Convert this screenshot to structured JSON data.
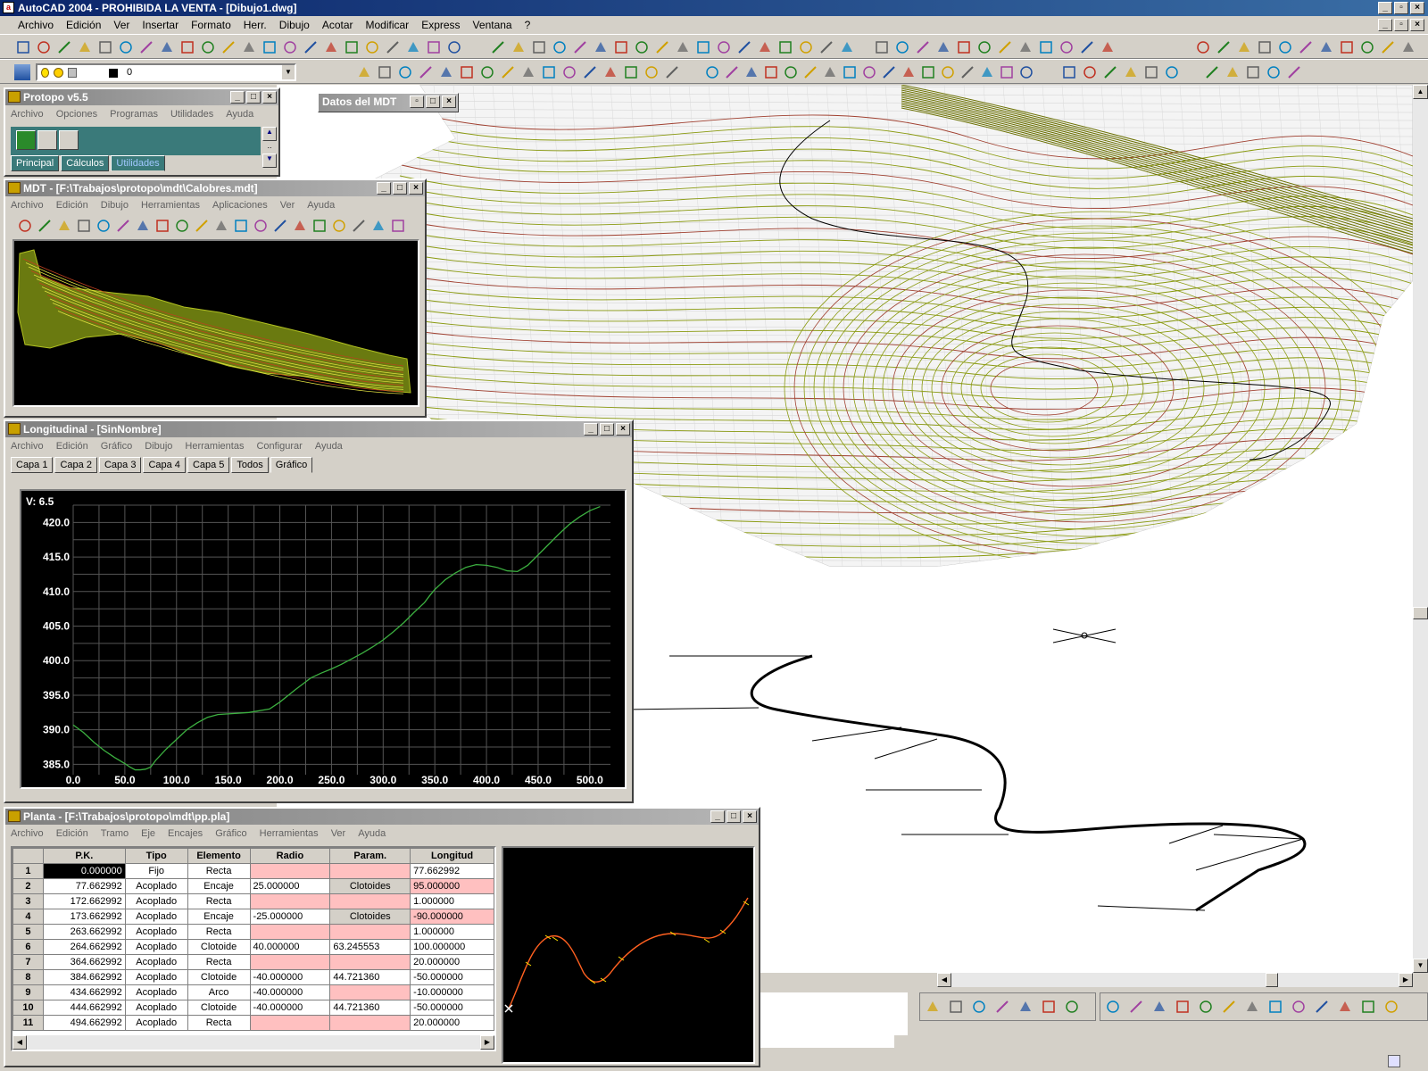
{
  "app": {
    "title": "AutoCAD 2004 - PROHIBIDA LA VENTA - [Dibujo1.dwg]",
    "menu": [
      "Archivo",
      "Edición",
      "Ver",
      "Insertar",
      "Formato",
      "Herr.",
      "Dibujo",
      "Acotar",
      "Modificar",
      "Express",
      "Ventana",
      "?"
    ],
    "layer_value": "0"
  },
  "protopo": {
    "title": "Protopo v5.5",
    "menu": [
      "Archivo",
      "Opciones",
      "Programas",
      "Utilidades",
      "Ayuda"
    ],
    "tabs": [
      "Principal",
      "Cálculos",
      "Utilidades"
    ]
  },
  "datos_mdt": {
    "title": "Datos del MDT"
  },
  "mdt": {
    "title": "MDT - [F:\\Trabajos\\protopo\\mdt\\Calobres.mdt]",
    "menu": [
      "Archivo",
      "Edición",
      "Dibujo",
      "Herramientas",
      "Aplicaciones",
      "Ver",
      "Ayuda"
    ]
  },
  "longitudinal": {
    "title": "Longitudinal - [SinNombre]",
    "menu": [
      "Archivo",
      "Edición",
      "Gráfico",
      "Dibujo",
      "Herramientas",
      "Configurar",
      "Ayuda"
    ],
    "tabs": [
      "Capa 1",
      "Capa 2",
      "Capa 3",
      "Capa 4",
      "Capa 5",
      "Todos",
      "Gráfico"
    ],
    "readout": "V: 6.5"
  },
  "chart_data": {
    "type": "line",
    "series": [
      {
        "x": [
          0,
          10,
          20,
          30,
          40,
          50,
          55,
          60,
          65,
          70,
          75,
          80,
          90,
          100,
          110,
          120,
          130,
          140,
          150,
          170,
          190,
          200,
          215,
          230,
          240,
          250,
          260,
          270,
          280,
          290,
          300,
          310,
          320,
          330,
          340,
          345,
          350,
          355,
          360,
          370,
          380,
          390,
          400,
          410,
          420,
          430,
          440,
          450,
          460,
          470,
          480,
          490,
          500,
          510
        ],
        "y": [
          390.7,
          389.6,
          388.2,
          387.0,
          386.0,
          385.1,
          384.6,
          384.2,
          384.2,
          384.3,
          384.6,
          385.6,
          387.2,
          388.6,
          390.0,
          391.0,
          391.8,
          392.2,
          392.3,
          392.5,
          393.0,
          394.0,
          395.8,
          397.5,
          398.2,
          398.8,
          399.5,
          400.3,
          401.1,
          402.0,
          403.0,
          404.2,
          405.5,
          407.0,
          408.4,
          409.4,
          410.3,
          411.0,
          411.7,
          412.7,
          413.5,
          413.9,
          413.8,
          413.5,
          413.0,
          412.9,
          413.8,
          415.3,
          416.8,
          418.3,
          419.7,
          420.8,
          421.7,
          422.3
        ]
      }
    ],
    "xticks": [
      "0.0",
      "50.0",
      "100.0",
      "150.0",
      "200.0",
      "250.0",
      "300.0",
      "350.0",
      "400.0",
      "450.0",
      "500.0"
    ],
    "yticks": [
      "385.0",
      "390.0",
      "395.0",
      "400.0",
      "405.0",
      "410.0",
      "415.0",
      "420.0"
    ],
    "xlim": [
      0,
      520
    ],
    "ylim": [
      383.5,
      422.5
    ],
    "grid": true,
    "line_color": "#3cb040",
    "background": "#000000"
  },
  "planta": {
    "title": "Planta - [F:\\Trabajos\\protopo\\mdt\\pp.pla]",
    "menu": [
      "Archivo",
      "Edición",
      "Tramo",
      "Eje",
      "Encajes",
      "Gráfico",
      "Herramientas",
      "Ver",
      "Ayuda"
    ],
    "columns": [
      "P.K.",
      "Tipo",
      "Elemento",
      "Radio",
      "Param.",
      "Longitud"
    ],
    "rows": [
      {
        "n": "1",
        "pk": "0.000000",
        "tipo": "Fijo",
        "elem": "Recta",
        "radio": "",
        "param": "",
        "long": "77.662992"
      },
      {
        "n": "2",
        "pk": "77.662992",
        "tipo": "Acoplado",
        "elem": "Encaje",
        "radio": "25.000000",
        "param": "Clotoides",
        "long": "95.000000"
      },
      {
        "n": "3",
        "pk": "172.662992",
        "tipo": "Acoplado",
        "elem": "Recta",
        "radio": "",
        "param": "",
        "long": "1.000000"
      },
      {
        "n": "4",
        "pk": "173.662992",
        "tipo": "Acoplado",
        "elem": "Encaje",
        "radio": "-25.000000",
        "param": "Clotoides",
        "long": "-90.000000"
      },
      {
        "n": "5",
        "pk": "263.662992",
        "tipo": "Acoplado",
        "elem": "Recta",
        "radio": "",
        "param": "",
        "long": "1.000000"
      },
      {
        "n": "6",
        "pk": "264.662992",
        "tipo": "Acoplado",
        "elem": "Clotoide",
        "radio": "40.000000",
        "param": "63.245553",
        "long": "100.000000"
      },
      {
        "n": "7",
        "pk": "364.662992",
        "tipo": "Acoplado",
        "elem": "Recta",
        "radio": "",
        "param": "",
        "long": "20.000000"
      },
      {
        "n": "8",
        "pk": "384.662992",
        "tipo": "Acoplado",
        "elem": "Clotoide",
        "radio": "-40.000000",
        "param": "44.721360",
        "long": "-50.000000"
      },
      {
        "n": "9",
        "pk": "434.662992",
        "tipo": "Acoplado",
        "elem": "Arco",
        "radio": "-40.000000",
        "param": "",
        "long": "-10.000000"
      },
      {
        "n": "10",
        "pk": "444.662992",
        "tipo": "Acoplado",
        "elem": "Clotoide",
        "radio": "-40.000000",
        "param": "44.721360",
        "long": "-50.000000"
      },
      {
        "n": "11",
        "pk": "494.662992",
        "tipo": "Acoplado",
        "elem": "Recta",
        "radio": "",
        "param": "",
        "long": "20.000000"
      }
    ]
  }
}
